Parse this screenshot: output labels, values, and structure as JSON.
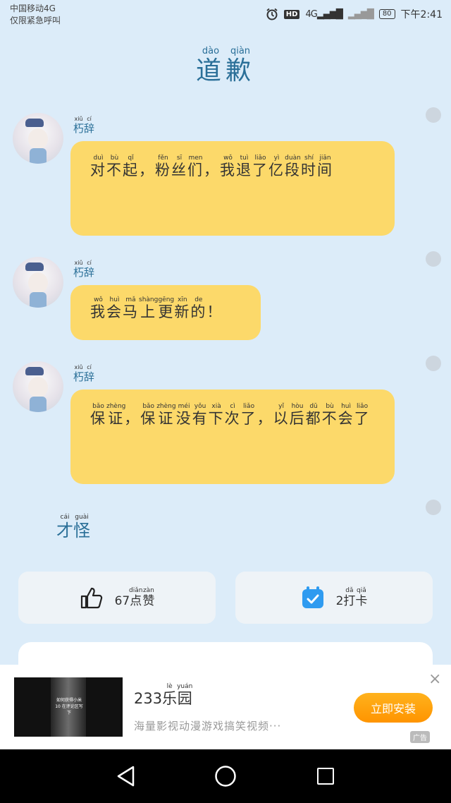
{
  "status_bar": {
    "carrier_line1": "中国移动4G",
    "carrier_line2": "仅限紧急呼叫",
    "hd": "HD",
    "signal": "4G",
    "battery": "80",
    "time": "下午2:41"
  },
  "title": {
    "chars": [
      [
        "道",
        "dào"
      ],
      [
        "歉",
        "qiàn"
      ]
    ]
  },
  "messages": [
    {
      "name": [
        [
          "朽",
          "xiǔ"
        ],
        [
          "辞",
          "cí"
        ]
      ],
      "text": [
        [
          "对",
          "duì"
        ],
        [
          "不",
          "bù"
        ],
        [
          "起",
          "qǐ"
        ],
        [
          "，",
          ""
        ],
        [
          "粉",
          "fěn"
        ],
        [
          "丝",
          "sī"
        ],
        [
          "们",
          "men"
        ],
        [
          "，",
          ""
        ],
        [
          "我",
          "wǒ"
        ],
        [
          "退",
          "tuì"
        ],
        [
          "了",
          "liǎo"
        ],
        [
          "亿",
          "yì"
        ],
        [
          "段",
          "duàn"
        ],
        [
          "时",
          "shí"
        ],
        [
          "间",
          "jiān"
        ]
      ]
    },
    {
      "name": [
        [
          "朽",
          "xiǔ"
        ],
        [
          "辞",
          "cí"
        ]
      ],
      "text": [
        [
          "我",
          "wǒ"
        ],
        [
          "会",
          "huì"
        ],
        [
          "马",
          "mǎ"
        ],
        [
          "上",
          "shàng"
        ],
        [
          "更",
          "gēng"
        ],
        [
          "新",
          "xīn"
        ],
        [
          "的",
          "de"
        ],
        [
          "！",
          ""
        ]
      ]
    },
    {
      "name": [
        [
          "朽",
          "xiǔ"
        ],
        [
          "辞",
          "cí"
        ]
      ],
      "text": [
        [
          "保",
          "bǎo"
        ],
        [
          "证",
          "zhèng"
        ],
        [
          "，",
          ""
        ],
        [
          "保",
          "bǎo"
        ],
        [
          "证",
          "zhèng"
        ],
        [
          "没",
          "méi"
        ],
        [
          "有",
          "yǒu"
        ],
        [
          "下",
          "xià"
        ],
        [
          "次",
          "cì"
        ],
        [
          "了",
          "liǎo"
        ],
        [
          "，",
          ""
        ],
        [
          "以",
          "yǐ"
        ],
        [
          "后",
          "hòu"
        ],
        [
          "都",
          "dū"
        ],
        [
          "不",
          "bù"
        ],
        [
          "会",
          "huì"
        ],
        [
          "了",
          "liǎo"
        ]
      ]
    }
  ],
  "tail_text": [
    [
      "才",
      "cái"
    ],
    [
      "怪",
      "guài"
    ]
  ],
  "actions": {
    "like_count": "67",
    "like_label": [
      [
        "点",
        "diǎn"
      ],
      [
        "赞",
        "zàn"
      ]
    ],
    "checkin_count": "2",
    "checkin_label": [
      [
        "打",
        "dǎ"
      ],
      [
        "卡",
        "qiǎ"
      ]
    ]
  },
  "ad": {
    "title_prefix": "233",
    "title_chars": [
      [
        "乐",
        "lè"
      ],
      [
        "园",
        "yuán"
      ]
    ],
    "description": "海量影视动漫游戏搞笑视频···",
    "button": "立即安装",
    "close": "×",
    "tag": "广告",
    "thumb_caption": "如何获得小米10 在评论区写下"
  },
  "colors": {
    "background": "#dcecf9",
    "bubble": "#fcd96a",
    "accent": "#2a6f98",
    "ad_button": "#ff9f0f"
  },
  "icons": [
    "alarm-icon",
    "signal-icon",
    "battery-icon",
    "thumbs-up-icon",
    "calendar-check-icon",
    "close-icon",
    "back-icon",
    "home-icon",
    "recent-apps-icon"
  ]
}
